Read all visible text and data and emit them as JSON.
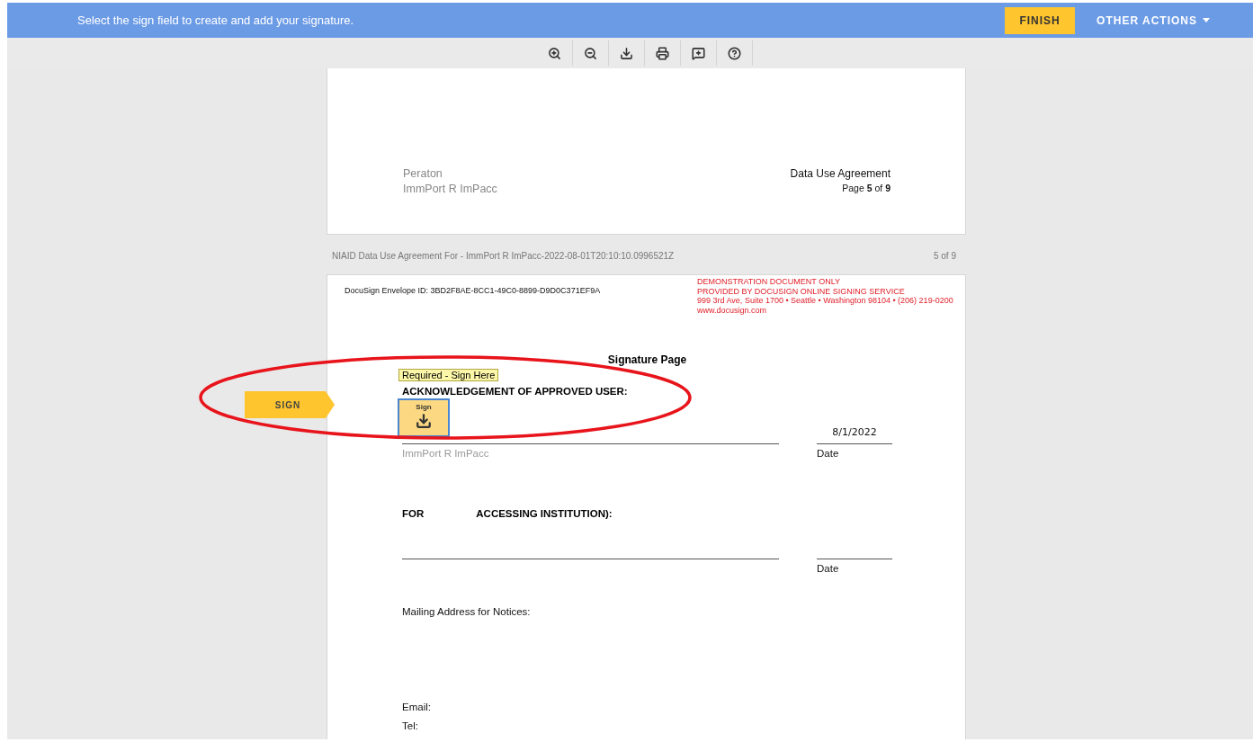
{
  "banner": {
    "message": "Select the sign field to create and add your signature.",
    "finish": "FINISH",
    "other_actions": "OTHER ACTIONS"
  },
  "toolbar": [
    {
      "kind": "zoom-in"
    },
    {
      "kind": "zoom-out"
    },
    {
      "kind": "download"
    },
    {
      "kind": "print"
    },
    {
      "kind": "comment"
    },
    {
      "kind": "help"
    }
  ],
  "previous_page": {
    "left_lines": [
      "Peraton",
      "ImmPort R ImPacc"
    ],
    "title": "Data Use Agreement",
    "page_label": "Page **5** of **9**"
  },
  "page_caption": {
    "name": "NIAID Data Use Agreement For - ImmPort R ImPacc-2022-08-01T20:10:10.0996521Z",
    "count": "5 of 9"
  },
  "current_page": {
    "envelope_id": "DocuSign Envelope ID: 3BD2F8AE-8CC1-49C0-8899-D9D0C371EF9A",
    "demo_notice": [
      "DEMONSTRATION DOCUMENT ONLY",
      "PROVIDED BY DOCUSIGN ONLINE SIGNING SERVICE",
      "999 3rd Ave, Suite 1700  • Seattle • Washington 98104 • (206) 219-0200",
      "www.docusign.com"
    ],
    "title": "Signature Page",
    "sign_tag": "SIGN",
    "tooltip": "Required - Sign Here",
    "sign_field": "Sign",
    "sections": [
      {
        "heading": [
          "ACKNOWLEDGEMENT OF APPROVED USER:"
        ],
        "date_value": "8/1/2022",
        "signer": "ImmPort R ImPacc",
        "date_label": "Date"
      },
      {
        "heading": [
          "FOR",
          "ACCESSING INSTITUTION):"
        ],
        "date_label": "Date"
      }
    ],
    "mailing": "Mailing Address for Notices:",
    "email": "Email:",
    "tel": "Tel:"
  }
}
